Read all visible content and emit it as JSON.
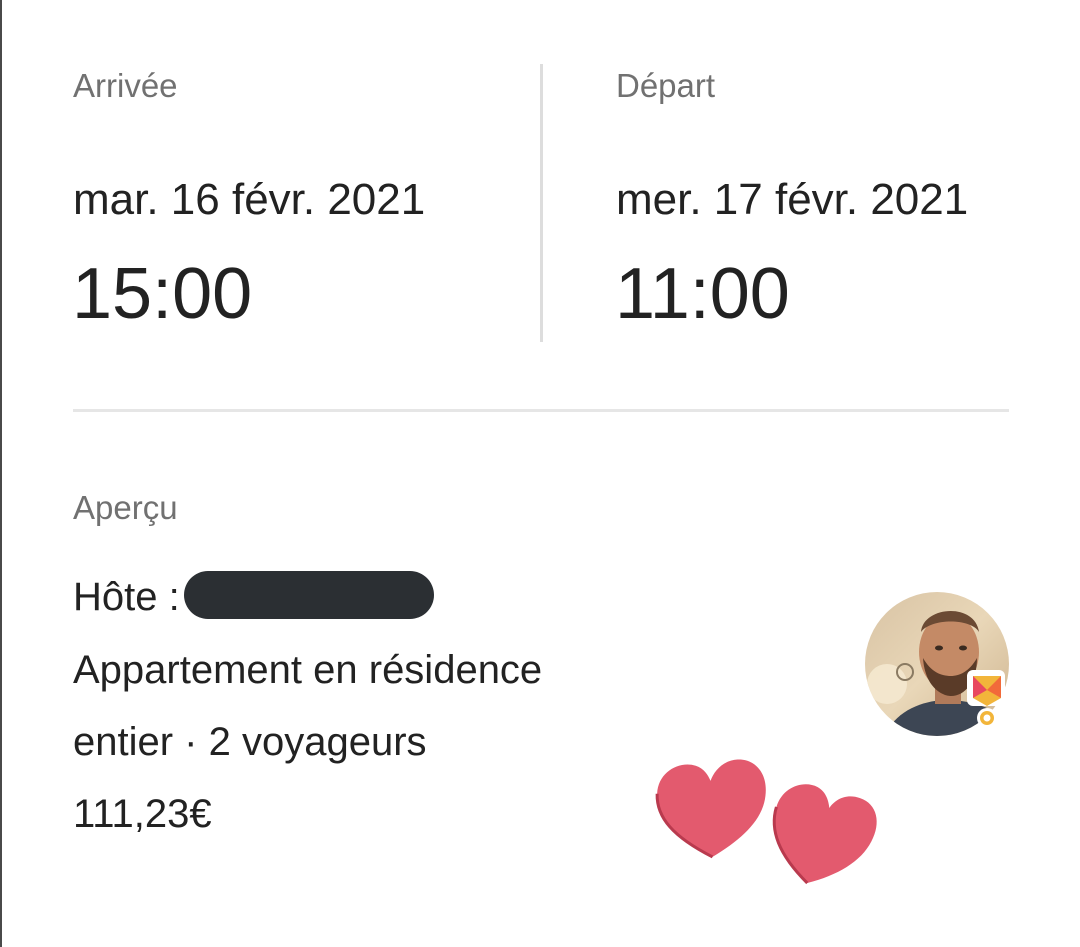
{
  "checkin": {
    "label": "Arrivée",
    "date": "mar. 16 févr. 2021",
    "time": "15:00"
  },
  "checkout": {
    "label": "Départ",
    "date": "mer. 17 févr. 2021",
    "time": "11:00"
  },
  "overview": {
    "label": "Aperçu",
    "host_label": "Hôte :",
    "listing_line1": "Appartement en résidence",
    "listing_line2": "entier · 2 voyageurs",
    "price": "111,23€"
  },
  "icons": {
    "avatar": "host-avatar",
    "badge": "superhost-badge-icon",
    "stickers": "heart-sticker-icon"
  },
  "colors": {
    "text_primary": "#222222",
    "text_secondary": "#717171",
    "heart": "#e35a6e",
    "redaction": "#2b2f33"
  }
}
